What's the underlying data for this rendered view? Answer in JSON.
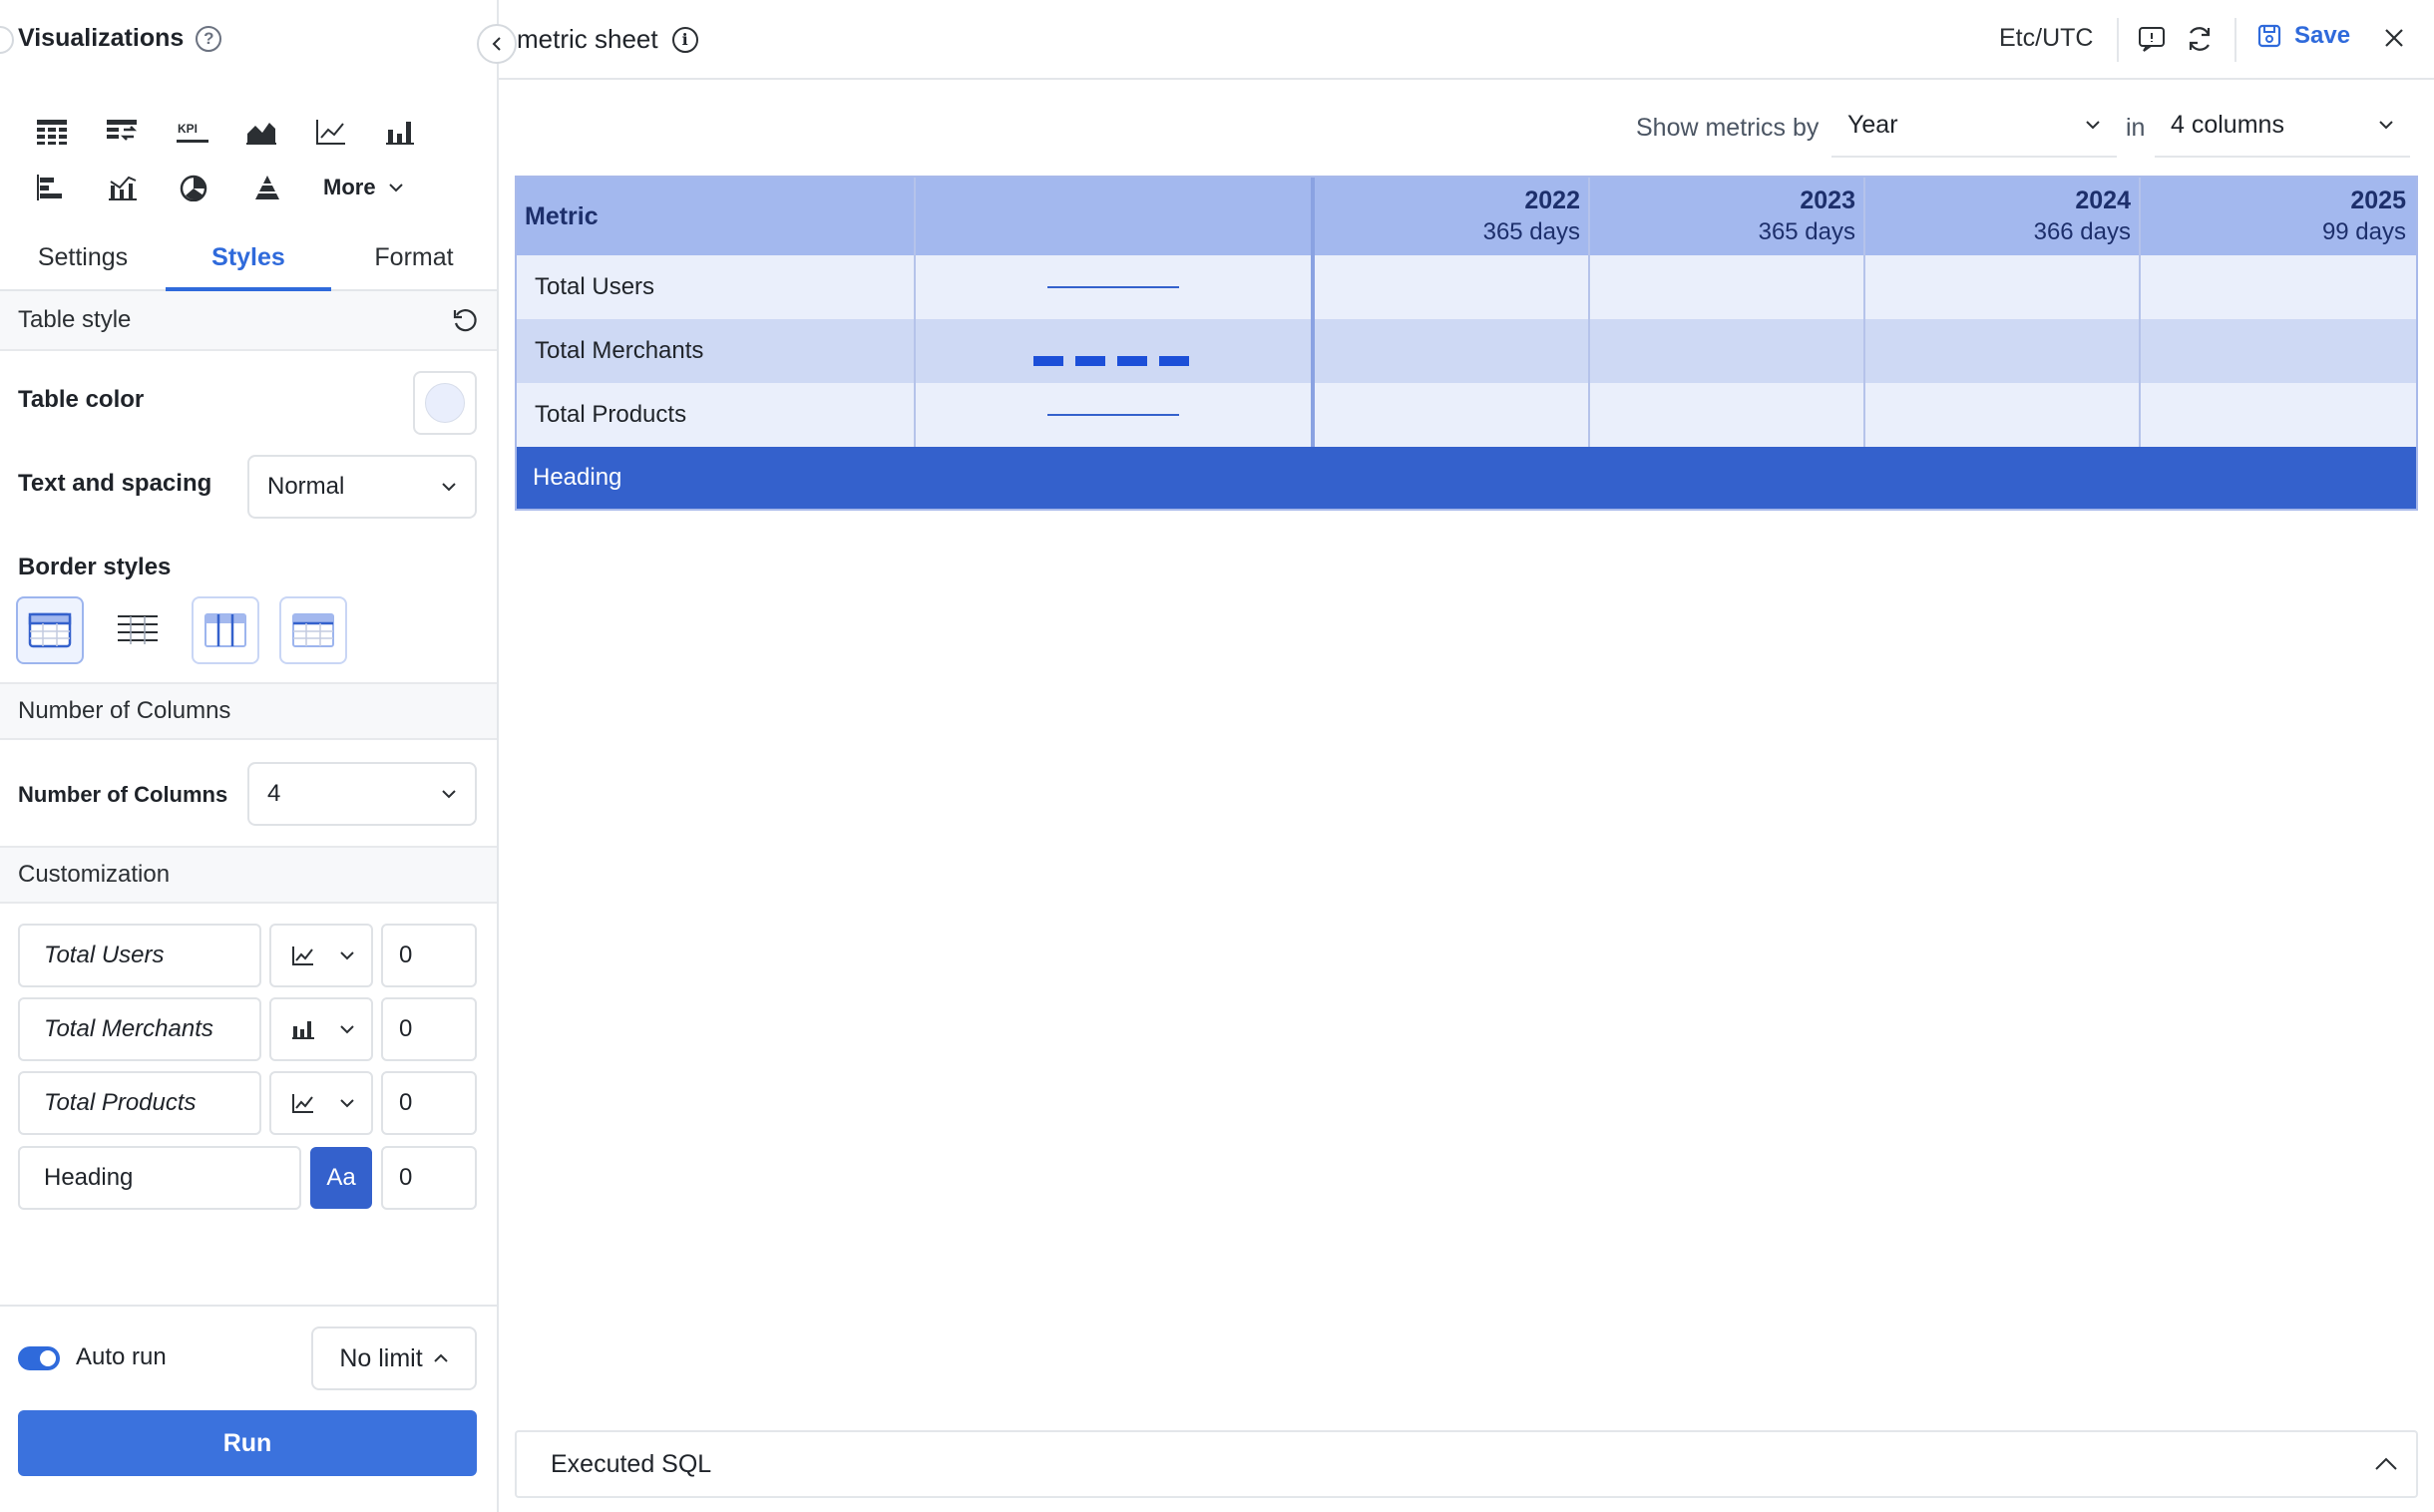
{
  "left_panel": {
    "title": "Visualizations",
    "help_icon": "question-circle-icon",
    "more_label": "More",
    "tabs": [
      {
        "label": "Settings",
        "active": false
      },
      {
        "label": "Styles",
        "active": true
      },
      {
        "label": "Format",
        "active": false
      }
    ],
    "table_style": {
      "section_title": "Table style",
      "table_color_label": "Table color",
      "table_color": "#e9eefc",
      "text_spacing_label": "Text and spacing",
      "text_spacing_value": "Normal",
      "border_styles_label": "Border styles"
    },
    "columns": {
      "section_title": "Number of Columns",
      "label": "Number of Columns",
      "value": "4"
    },
    "customization": {
      "section_title": "Customization",
      "rows": [
        {
          "name": "Total Users",
          "type_icon": "line-chart-icon",
          "value": "0"
        },
        {
          "name": "Total Merchants",
          "type_icon": "bar-chart-icon",
          "value": "0"
        },
        {
          "name": "Total Products",
          "type_icon": "line-chart-icon",
          "value": "0"
        },
        {
          "name": "Heading",
          "type_label": "Aa",
          "value": "0"
        }
      ]
    },
    "auto_run_label": "Auto run",
    "auto_run_on": true,
    "limit_label": "No limit",
    "run_label": "Run"
  },
  "topbar": {
    "title": "metric sheet",
    "timezone": "Etc/UTC",
    "save_label": "Save"
  },
  "controls": {
    "show_label": "Show metrics by",
    "period": "Year",
    "in_label": "in",
    "columns": "4 columns"
  },
  "table": {
    "metric_header": "Metric",
    "years": [
      {
        "year": "2022",
        "days": "365 days"
      },
      {
        "year": "2023",
        "days": "365 days"
      },
      {
        "year": "2024",
        "days": "366 days"
      },
      {
        "year": "2025",
        "days": "99 days"
      }
    ],
    "rows": [
      {
        "label": "Total Users",
        "spark": "line"
      },
      {
        "label": "Total Merchants",
        "spark": "bar"
      },
      {
        "label": "Total Products",
        "spark": "line"
      }
    ],
    "heading_row": "Heading"
  },
  "executed_sql_label": "Executed SQL",
  "colors": {
    "accent": "#2f6adb",
    "header_bg": "#a3b8ee",
    "heading_bg": "#3461cc"
  }
}
